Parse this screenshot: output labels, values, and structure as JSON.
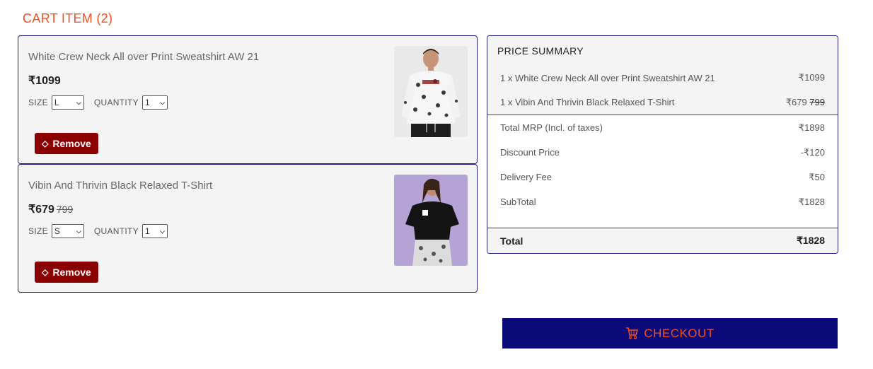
{
  "cart": {
    "title": "CART ITEM (2)",
    "items": [
      {
        "name": "White Crew Neck All over Print Sweatshirt AW 21",
        "price": "₹1099",
        "old_price": "",
        "size_label": "SIZE",
        "size_value": "L",
        "quantity_label": "QUANTITY",
        "quantity_value": "1",
        "remove_label": "Remove"
      },
      {
        "name": "Vibin And Thrivin Black Relaxed T-Shirt",
        "price": "₹679",
        "old_price": "799",
        "size_label": "SIZE",
        "size_value": "S",
        "quantity_label": "QUANTITY",
        "quantity_value": "1",
        "remove_label": "Remove"
      }
    ]
  },
  "summary": {
    "title": "PRICE SUMMARY",
    "lines": [
      {
        "label": "1 x White Crew Neck All over Print Sweatshirt AW 21",
        "value": "₹1099",
        "old": ""
      },
      {
        "label": "1 x Vibin And Thrivin Black Relaxed T-Shirt",
        "value": "₹679",
        "old": "799"
      }
    ],
    "totals": [
      {
        "label": "Total MRP (Incl. of taxes)",
        "value": "₹1898"
      },
      {
        "label": "Discount Price",
        "value": "-₹120"
      },
      {
        "label": "Delivery Fee",
        "value": "₹50"
      },
      {
        "label": "SubTotal",
        "value": "₹1828"
      }
    ],
    "total_label": "Total",
    "total_value": "₹1828"
  },
  "checkout": {
    "label": "CHECKOUT"
  },
  "colors": {
    "accent": "#f4511e",
    "remove": "#8b0000",
    "checkout_bg": "#0a0a78",
    "border": "#1f1f7a"
  },
  "icons": {
    "remove": "eraser-icon",
    "checkout": "cart-icon",
    "select": "chevron-down-icon"
  }
}
